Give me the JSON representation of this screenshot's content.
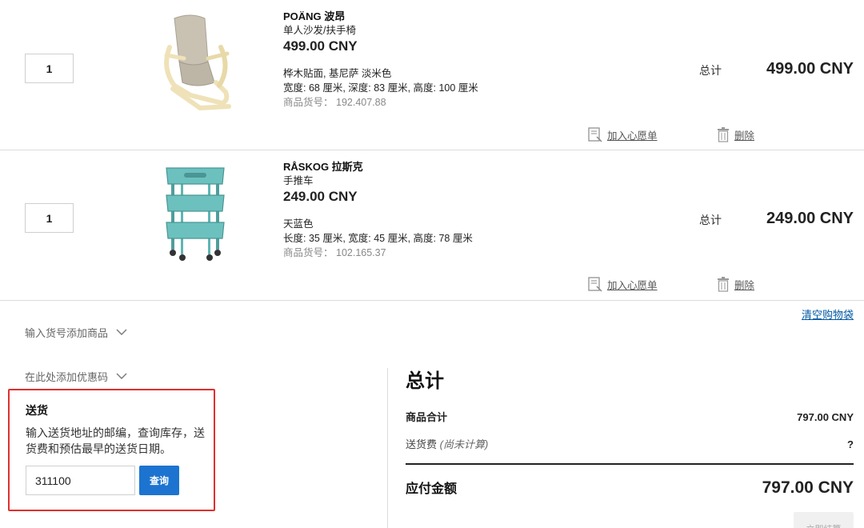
{
  "items": [
    {
      "quantity": "1",
      "name": "POÄNG 波昂",
      "category": "单人沙发/扶手椅",
      "unit_price": "499.00 CNY",
      "color": "桦木贴面, 基尼萨 淡米色",
      "dimensions": "宽度: 68 厘米, 深度: 83 厘米, 高度: 100 厘米",
      "article_label": "商品货号：",
      "article_number": "192.407.88",
      "total_label": "总计",
      "line_total": "499.00 CNY",
      "wishlist_label": "加入心愿单",
      "remove_label": "删除",
      "image_icon": "armchair-image"
    },
    {
      "quantity": "1",
      "name": "RÅSKOG 拉斯克",
      "category": "手推车",
      "unit_price": "249.00 CNY",
      "color": "天蓝色",
      "dimensions": "长度: 35 厘米, 宽度: 45 厘米, 高度: 78 厘米",
      "article_label": "商品货号：",
      "article_number": "102.165.37",
      "total_label": "总计",
      "line_total": "249.00 CNY",
      "wishlist_label": "加入心愿单",
      "remove_label": "删除",
      "image_icon": "trolley-image"
    }
  ],
  "clear_bag_label": "清空购物袋",
  "add_by_article_label": "输入货号添加商品",
  "add_coupon_label": "在此处添加优惠码",
  "delivery": {
    "title": "送货",
    "description": "输入送货地址的邮编，查询库存，送货费和预估最早的送货日期。",
    "zip_value": "311100",
    "query_label": "查询"
  },
  "summary": {
    "title": "总计",
    "subtotal_label": "商品合计",
    "subtotal_value": "797.00 CNY",
    "shipping_label": "送货费",
    "shipping_note": "(尚未计算)",
    "shipping_value": "?",
    "grand_total_label": "应付金额",
    "grand_total_value": "797.00 CNY"
  },
  "checkout_label": "立即结算",
  "colors": {
    "link_blue": "#0058a3",
    "button_blue": "#1c74d0",
    "highlight_red": "#e0302f",
    "trolley_teal": "#5fb5b3",
    "chair_beige": "#c9c2b3"
  }
}
